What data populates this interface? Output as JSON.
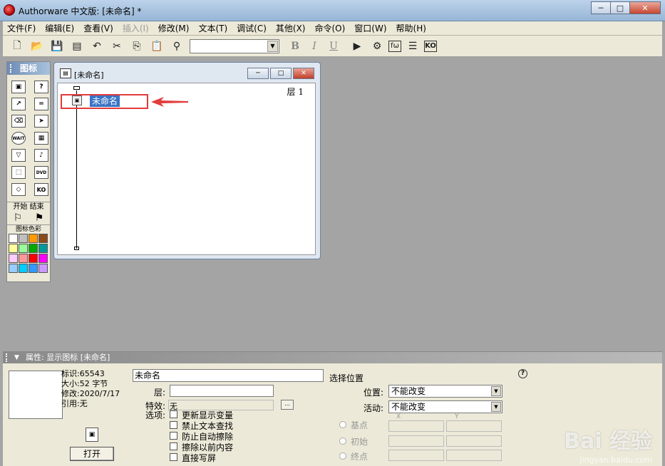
{
  "window": {
    "title": "Authorware 中文版: [未命名] *",
    "minimize": "─",
    "maximize": "□",
    "close": "✕"
  },
  "menu": [
    {
      "label": "文件(F)",
      "enabled": true
    },
    {
      "label": "编辑(E)",
      "enabled": true
    },
    {
      "label": "查看(V)",
      "enabled": true
    },
    {
      "label": "插入(I)",
      "enabled": false
    },
    {
      "label": "修改(M)",
      "enabled": true
    },
    {
      "label": "文本(T)",
      "enabled": true
    },
    {
      "label": "调试(C)",
      "enabled": true
    },
    {
      "label": "其他(X)",
      "enabled": true
    },
    {
      "label": "命令(O)",
      "enabled": true
    },
    {
      "label": "窗口(W)",
      "enabled": true
    },
    {
      "label": "帮助(H)",
      "enabled": true
    }
  ],
  "toolbar": {
    "icons": {
      "new": "🗋",
      "open": "📂",
      "save": "💾",
      "import": "▤",
      "undo": "↶",
      "cut": "✂",
      "copy": "⎘",
      "paste": "📋",
      "find": "⚲"
    },
    "style_select_value": "",
    "bold": "B",
    "italic": "I",
    "underline": "U",
    "run": "▶",
    "control_panel": "⚙",
    "functions": "fω",
    "variables": "☰",
    "knowledge_objects": "KO"
  },
  "palette": {
    "title": "图标",
    "icons": [
      {
        "name": "display-icon",
        "glyph": "▣"
      },
      {
        "name": "interaction-icon",
        "glyph": "?"
      },
      {
        "name": "motion-icon",
        "glyph": "↗"
      },
      {
        "name": "calculation-icon",
        "glyph": "="
      },
      {
        "name": "erase-icon",
        "glyph": "⌫"
      },
      {
        "name": "navigate-icon",
        "glyph": "➤"
      },
      {
        "name": "wait-icon",
        "glyph": "WAIT"
      },
      {
        "name": "framework-icon",
        "glyph": "▦"
      },
      {
        "name": "decision-icon",
        "glyph": "▽"
      },
      {
        "name": "sound-icon",
        "glyph": "♪"
      },
      {
        "name": "map-icon",
        "glyph": "⬚"
      },
      {
        "name": "dvd-icon",
        "glyph": "DVD"
      },
      {
        "name": "decision-diamond-icon",
        "glyph": "◇"
      },
      {
        "name": "ko-icon",
        "glyph": "KO"
      }
    ],
    "start_end_label": "开始 结束",
    "start_flag": "⚐",
    "end_flag": "⚑",
    "color_label": "图标色彩",
    "colors": [
      "#ffffff",
      "#c0c0c0",
      "#ff9900",
      "#8a4a1a",
      "#ffff99",
      "#99ff99",
      "#00aa00",
      "#009999",
      "#ffccff",
      "#ff9999",
      "#ff0000",
      "#ff00ff",
      "#99ccff",
      "#00ccff",
      "#3399ff",
      "#cc99ff"
    ]
  },
  "flow_window": {
    "title": "[未命名]",
    "layer": "层 1",
    "icon_label": "未命名",
    "icon_glyph": "▣"
  },
  "properties": {
    "header": "属性: 显示图标 [未命名]",
    "info": [
      "标识:65543",
      "大小:52 字节",
      "修改:2020/7/17",
      "引用:无"
    ],
    "open_button": "打开",
    "name_value": "未命名",
    "layer_label": "层:",
    "layer_value": "",
    "effect_label": "特效:",
    "effect_value": "无",
    "effect_button": "...",
    "options_label": "选项:",
    "options": [
      {
        "label": "更新显示变量",
        "checked": false
      },
      {
        "label": "禁止文本查找",
        "checked": false
      },
      {
        "label": "防止自动擦除",
        "checked": false
      },
      {
        "label": "擦除以前内容",
        "checked": false
      },
      {
        "label": "直接写屏",
        "checked": false
      }
    ],
    "select_position_title": "选择位置",
    "position_label": "位置:",
    "position_value": "不能改变",
    "movable_label": "活动:",
    "movable_value": "不能改变",
    "radios": [
      "基点",
      "初始",
      "终点"
    ],
    "x_label": "X",
    "y_label": "Y",
    "help": "?"
  },
  "watermark": {
    "brand": "Bai 经验",
    "url": "jingyan.baidu.com"
  }
}
